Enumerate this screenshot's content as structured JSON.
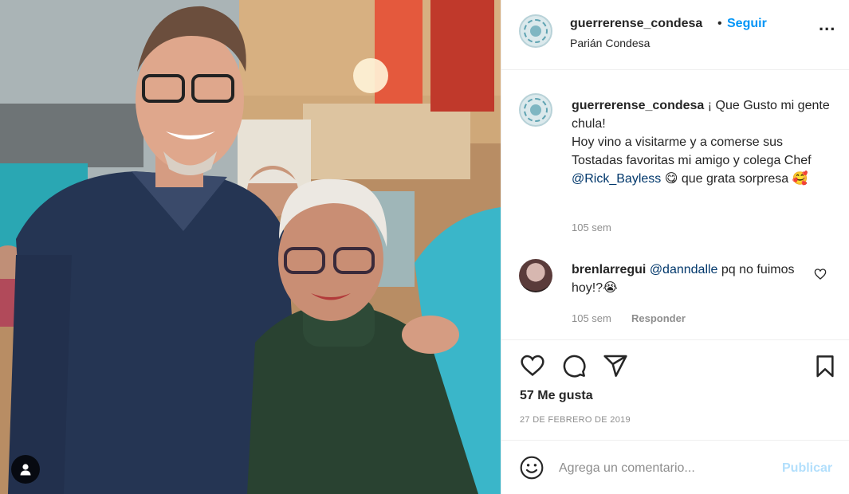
{
  "post": {
    "username": "guerrerense_condesa",
    "follow_label": "Seguir",
    "separator": "•",
    "location": "Parián Condesa",
    "more_label": "..."
  },
  "caption": {
    "username": "guerrerense_condesa",
    "text_start": " ¡ Que Gusto mi gente chula!",
    "text_line2": "Hoy vino a visitarme y a comerse sus Tostadas favoritas mi amigo y colega Chef ",
    "mention": "@Rick_Bayless",
    "text_end": " 😋 que grata sorpresa 🥰",
    "time": "105 sem"
  },
  "comment": {
    "username": "brenlarregui",
    "mention": "@danndalle",
    "text": " pq no fuimos hoy!?😭",
    "time": "105 sem",
    "reply_label": "Responder"
  },
  "stats": {
    "likes": "57 Me gusta",
    "date": "27 DE FEBRERO DE 2019"
  },
  "add_comment": {
    "placeholder": "Agrega un comentario...",
    "publish_label": "Publicar"
  },
  "colors": {
    "accent": "#0095f6",
    "publish_disabled": "#b2dffc",
    "secondary_text": "#8e8e8e",
    "mention": "#00376b"
  },
  "icons": [
    "heart-icon",
    "comment-icon",
    "share-icon",
    "bookmark-icon",
    "emoji-icon",
    "more-icon",
    "user-tag-icon"
  ]
}
